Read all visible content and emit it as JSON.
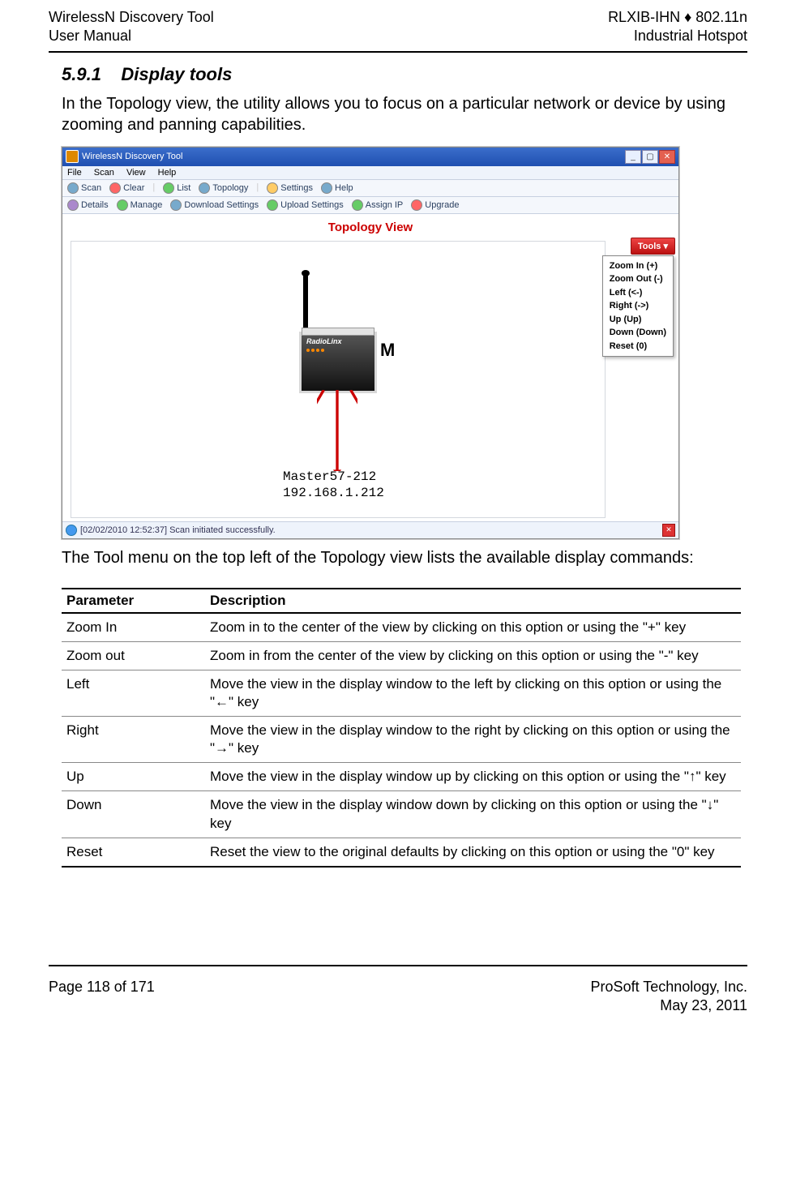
{
  "header": {
    "left_line1": "WirelessN Discovery Tool",
    "left_line2": "User Manual",
    "right_line1": "RLXIB-IHN ♦ 802.11n",
    "right_line2": "Industrial Hotspot"
  },
  "footer": {
    "left": "Page 118 of 171",
    "right_line1": "ProSoft Technology, Inc.",
    "right_line2": "May 23, 2011"
  },
  "section": {
    "number": "5.9.1",
    "title": "Display tools",
    "intro": "In the Topology view, the utility allows you to focus on a particular network or device by using zooming and panning capabilities.",
    "after_image": "The Tool menu on the top left of the Topology view lists the available display commands:"
  },
  "screenshot": {
    "window_title": "WirelessN Discovery Tool",
    "menus": [
      "File",
      "Scan",
      "View",
      "Help"
    ],
    "toolbar1": [
      "Scan",
      "Clear",
      "List",
      "Topology",
      "Settings",
      "Help"
    ],
    "toolbar2": [
      "Details",
      "Manage",
      "Download Settings",
      "Upload Settings",
      "Assign IP",
      "Upgrade"
    ],
    "view_title": "Topology View",
    "device_brand": "RadioLinx",
    "m_label": "M",
    "node_label1": "Master57-212",
    "node_label2": "192.168.1.212",
    "tools_button": "Tools ▾",
    "tools_menu": [
      "Zoom In (+)",
      "Zoom Out (-)",
      "Left (<-)",
      "Right (->)",
      "Up (Up)",
      "Down (Down)",
      "Reset (0)"
    ],
    "status_text": "[02/02/2010 12:52:37] Scan initiated successfully."
  },
  "table": {
    "headers": {
      "param": "Parameter",
      "desc": "Description"
    },
    "rows": [
      {
        "param": "Zoom In",
        "desc": "Zoom in to the center of the view by clicking on this option or using the \"+\" key"
      },
      {
        "param": "Zoom out",
        "desc": "Zoom in from the center of the view by clicking on this option or using the \"-\" key"
      },
      {
        "param": "Left",
        "desc": "Move the view in the display window to the left by clicking on this option or using the \"←\" key"
      },
      {
        "param": "Right",
        "desc": "Move the view in the display window to the right by clicking on this option or using the \"→\" key"
      },
      {
        "param": "Up",
        "desc": "Move the view in the display window up by clicking on this option or using the \"↑\" key"
      },
      {
        "param": "Down",
        "desc": "Move the view in the display window down by clicking on this option or using the \"↓\" key"
      },
      {
        "param": "Reset",
        "desc": "Reset the view to the original defaults by clicking on this option or using the \"0\" key"
      }
    ]
  }
}
